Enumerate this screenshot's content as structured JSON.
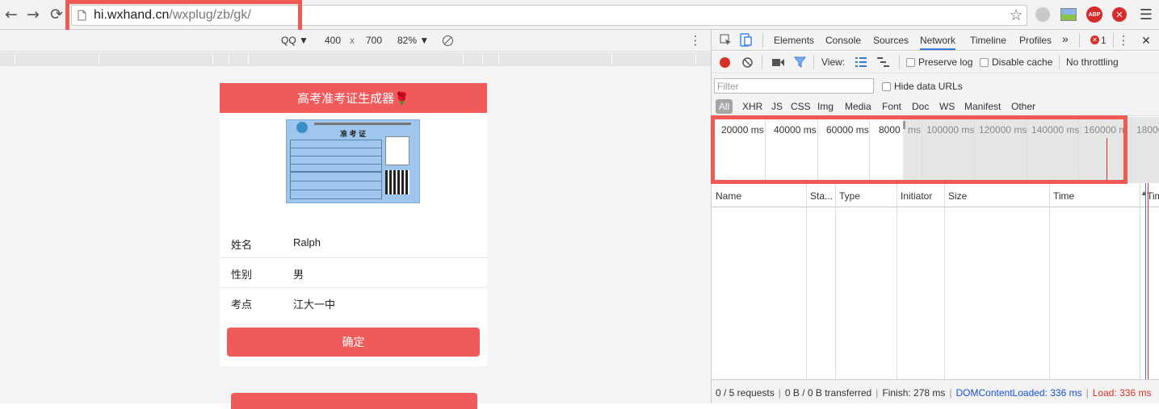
{
  "browser": {
    "url_host": "hi.wxhand.cn",
    "url_path": "/wxplug/zb/gk/",
    "toolbar_icons": [
      "back-arrow-icon",
      "forward-arrow-icon",
      "reload-icon",
      "page-icon",
      "star-icon",
      "extension-icon",
      "image-extension-icon",
      "adblock-plus-icon",
      "close-extension-icon",
      "menu-icon"
    ],
    "abp_text": "ABP"
  },
  "device_bar": {
    "device": "QQ ▼",
    "width": "400",
    "times": "x",
    "height": "700",
    "zoom": "82% ▼"
  },
  "page": {
    "header": "高考准考证生成器🌹",
    "card_title": "准 考 证",
    "fields": [
      {
        "label": "姓名",
        "value": "Ralph"
      },
      {
        "label": "性别",
        "value": "男"
      },
      {
        "label": "考点",
        "value": "江大一中"
      }
    ],
    "confirm_button": "确定"
  },
  "devtools": {
    "tabs": [
      "Elements",
      "Console",
      "Sources",
      "Network",
      "Timeline",
      "Profiles"
    ],
    "active_tab": "Network",
    "more_tabs": "»",
    "error_count": "1",
    "view_label": "View:",
    "preserve_log": "Preserve log",
    "disable_cache": "Disable cache",
    "throttling": "No throttling",
    "filter_placeholder": "Filter",
    "hide_data_urls": "Hide data URLs",
    "type_filters": [
      "All",
      "XHR",
      "JS",
      "CSS",
      "Img",
      "Media",
      "Font",
      "Doc",
      "WS",
      "Manifest",
      "Other"
    ],
    "timeline_labels": [
      "20000 ms",
      "40000 ms",
      "60000 ms",
      "8000",
      "ms",
      "100000 ms",
      "120000 ms",
      "140000 ms",
      "160000 m",
      "18000"
    ],
    "columns": [
      "Name",
      "Sta...",
      "Type",
      "Initiator",
      "Size",
      "Time",
      "Time"
    ],
    "status": {
      "requests": "0 / 5 requests",
      "transferred": "0 B / 0 B transferred",
      "finish": "Finish: 278 ms",
      "dcl": "DOMContentLoaded: 336 ms",
      "load": "Load: 336 ms"
    },
    "colors": {
      "dcl": "#1a4fd6",
      "load": "#d93025",
      "record": "#d93025",
      "accent": "#f05a5b"
    }
  }
}
